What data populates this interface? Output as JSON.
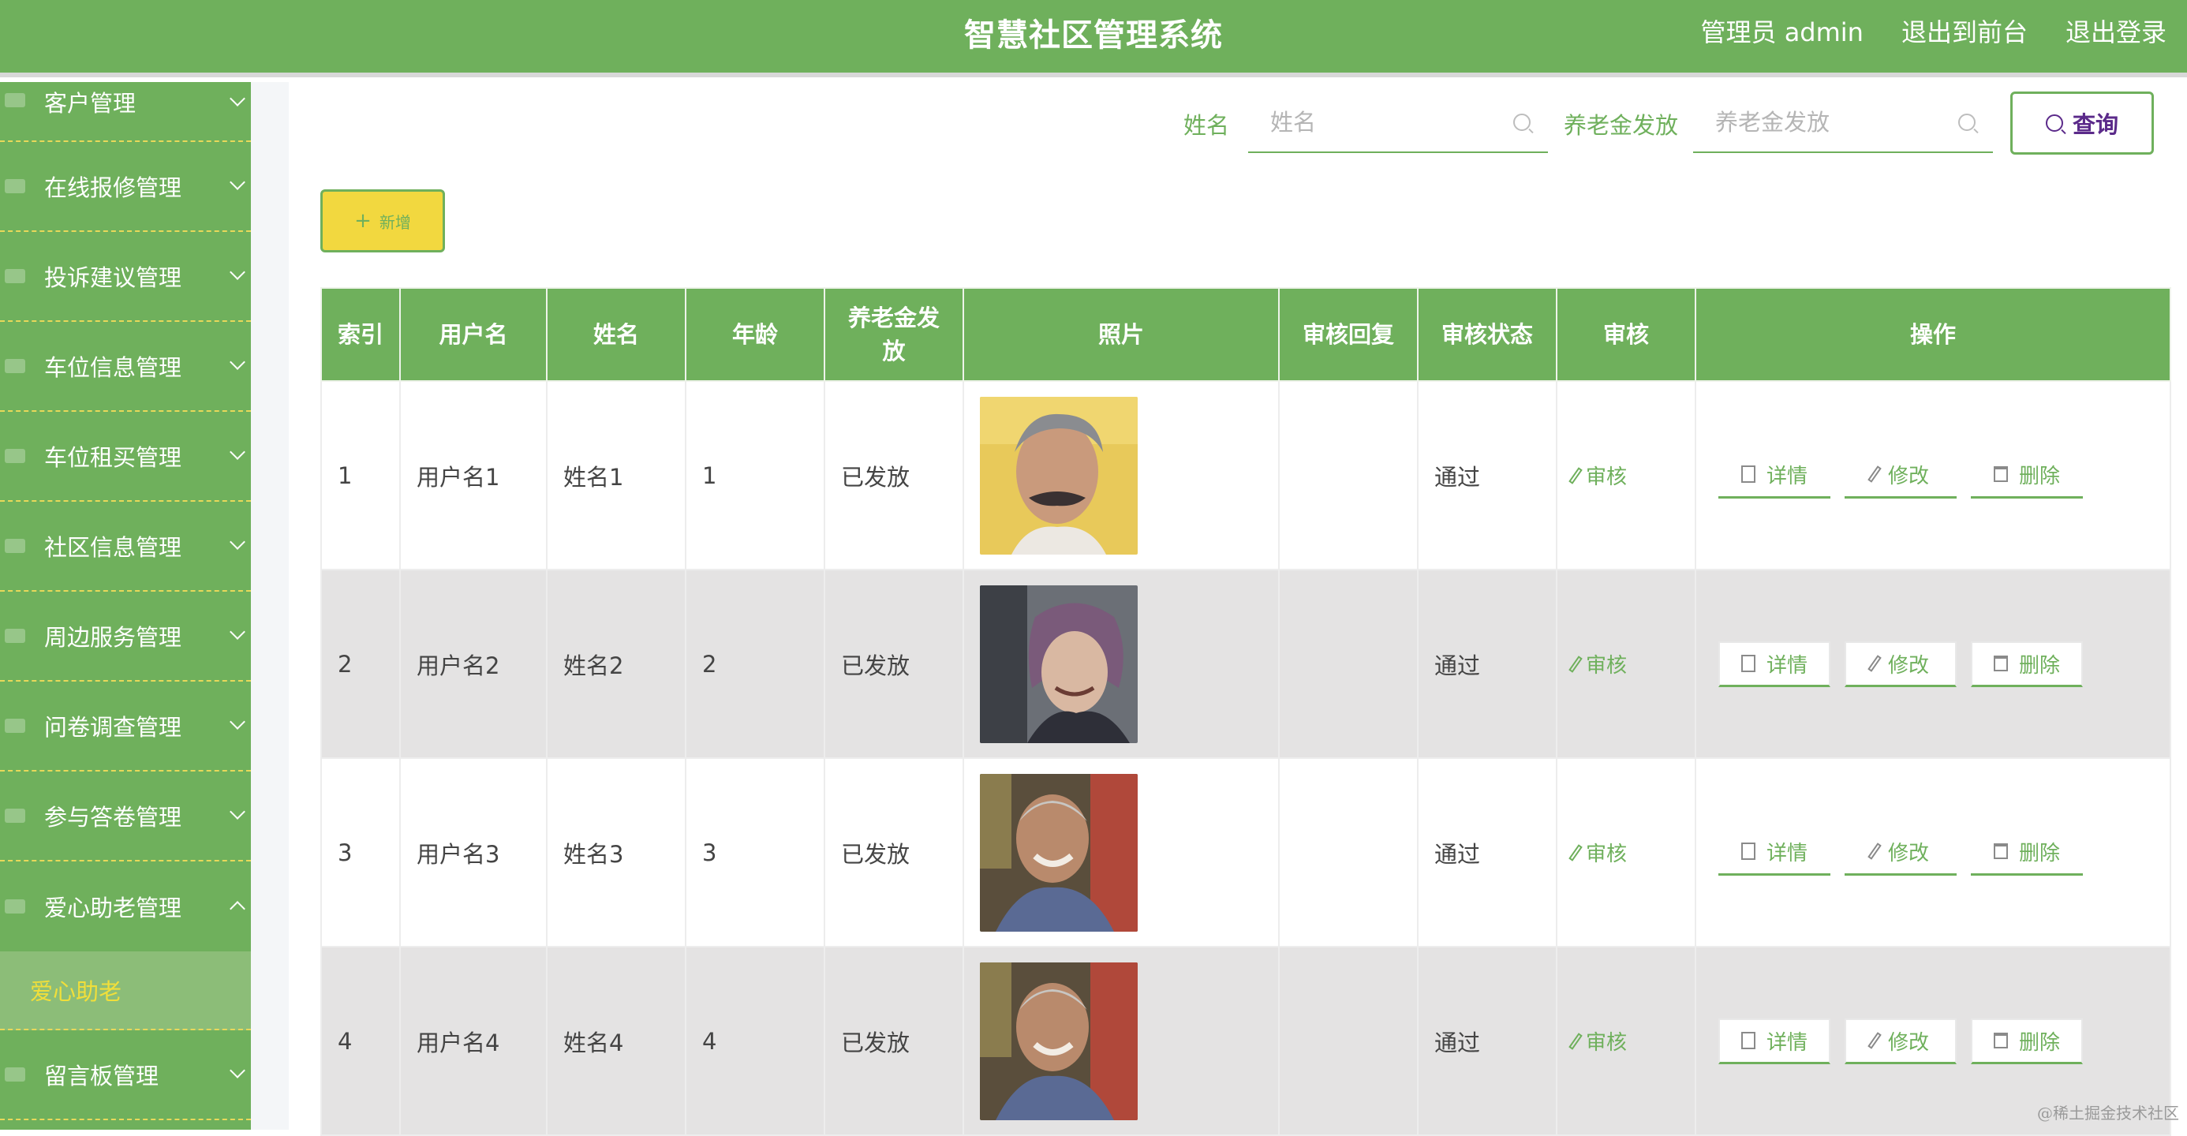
{
  "header": {
    "title": "智慧社区管理系统",
    "links": [
      "管理员 admin",
      "退出到前台",
      "退出登录"
    ]
  },
  "sidebar": {
    "items": [
      {
        "label": "客户管理",
        "expanded": false
      },
      {
        "label": "在线报修管理",
        "expanded": false
      },
      {
        "label": "投诉建议管理",
        "expanded": false
      },
      {
        "label": "车位信息管理",
        "expanded": false
      },
      {
        "label": "车位租买管理",
        "expanded": false
      },
      {
        "label": "社区信息管理",
        "expanded": false
      },
      {
        "label": "周边服务管理",
        "expanded": false
      },
      {
        "label": "问卷调查管理",
        "expanded": false
      },
      {
        "label": "参与答卷管理",
        "expanded": false
      },
      {
        "label": "爱心助老管理",
        "expanded": true
      },
      {
        "label": "留言板管理",
        "expanded": false
      }
    ],
    "active_sub": "爱心助老"
  },
  "search": {
    "name_label": "姓名",
    "name_placeholder": "姓名",
    "pension_label": "养老金发放",
    "pension_placeholder": "养老金发放",
    "query_label": "查询"
  },
  "toolbar": {
    "add_label": "新增"
  },
  "table": {
    "columns": [
      "索引",
      "用户名",
      "姓名",
      "年龄",
      "养老金发放",
      "照片",
      "审核回复",
      "审核状态",
      "审核",
      "操作"
    ],
    "rows": [
      {
        "index": "1",
        "username": "用户名1",
        "name": "姓名1",
        "age": "1",
        "pension": "已发放",
        "reply": "",
        "status": "通过"
      },
      {
        "index": "2",
        "username": "用户名2",
        "name": "姓名2",
        "age": "2",
        "pension": "已发放",
        "reply": "",
        "status": "通过"
      },
      {
        "index": "3",
        "username": "用户名3",
        "name": "姓名3",
        "age": "3",
        "pension": "已发放",
        "reply": "",
        "status": "通过"
      },
      {
        "index": "4",
        "username": "用户名4",
        "name": "姓名4",
        "age": "4",
        "pension": "已发放",
        "reply": "",
        "status": "通过"
      }
    ],
    "review_label": "审核",
    "detail_label": "详情",
    "edit_label": "修改",
    "delete_label": "删除"
  },
  "watermark": "@稀土掘金技术社区",
  "colors": {
    "primary": "#6fb05c",
    "accent_yellow": "#f2d83f",
    "query_text": "#5b2a8a"
  }
}
